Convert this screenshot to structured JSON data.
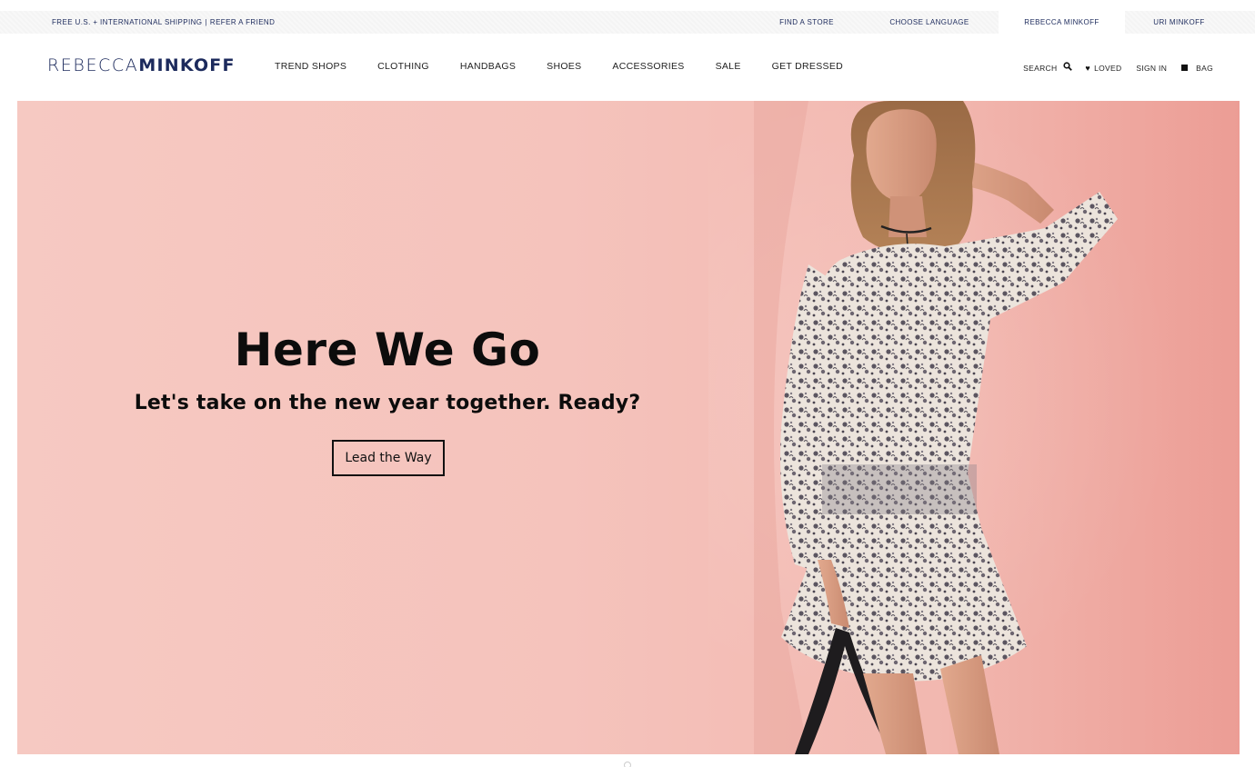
{
  "utility_bar": {
    "promo_shipping": "FREE U.S. + INTERNATIONAL SHIPPING",
    "promo_separator": "|",
    "promo_refer": "REFER A FRIEND",
    "find_store": "FIND A STORE",
    "choose_language": "CHOOSE LANGUAGE",
    "brand_tab_1": "REBECCA MINKOFF",
    "brand_tab_2": "URI MINKOFF"
  },
  "header": {
    "logo_part1": "REBECCA",
    "logo_part2": "MINKOFF",
    "nav": [
      "TREND SHOPS",
      "CLOTHING",
      "HANDBAGS",
      "SHOES",
      "ACCESSORIES",
      "SALE",
      "GET DRESSED"
    ],
    "search_label": "SEARCH",
    "loved_label": "LOVED",
    "sign_in_label": "SIGN IN",
    "bag_label": "BAG"
  },
  "hero": {
    "headline": "Here We Go",
    "subheadline": "Let's take on the new year together. Ready?",
    "cta": "Lead the Way"
  },
  "colors": {
    "brand_navy": "#1c2a5c",
    "hero_pink": "#f6c9c2",
    "text_dark": "#111111"
  },
  "icons": {
    "search": "search-icon",
    "loved": "heart-icon",
    "bag": "bag-icon"
  }
}
